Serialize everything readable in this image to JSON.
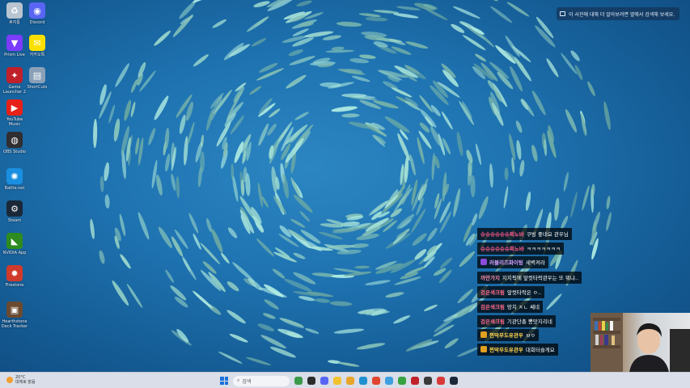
{
  "desktop": {
    "icons": [
      {
        "name": "recycle-bin",
        "label": "휴지통",
        "color": "#b8c4d0",
        "glyph": "♻"
      },
      {
        "name": "discord",
        "label": "Discord",
        "color": "#5865f2",
        "glyph": "◉"
      },
      {
        "name": "prism-live",
        "label": "Prism Live",
        "color": "#7a3cff",
        "glyph": "▼"
      },
      {
        "name": "kakaotalk",
        "label": "카카오톡",
        "color": "#f9e000",
        "glyph": "✉"
      },
      {
        "name": "game-app",
        "label": "Game Launcher 2",
        "color": "#c0202a",
        "glyph": "✦"
      },
      {
        "name": "shortcut",
        "label": "ShortCuts",
        "color": "#8aa0b8",
        "glyph": "▤"
      },
      {
        "name": "youtube-music",
        "label": "YouTube Music",
        "color": "#e62117",
        "glyph": "▶"
      },
      {
        "name": "obs-studio",
        "label": "OBS Studio",
        "color": "#302e31",
        "glyph": "◍"
      },
      {
        "name": "battlenet",
        "label": "Battle.net",
        "color": "#1a8fe0",
        "glyph": "✺"
      },
      {
        "name": "steam",
        "label": "Steam",
        "color": "#1b2838",
        "glyph": "⚙"
      },
      {
        "name": "nvidia",
        "label": "NVIDIA App",
        "color": "#2e8b1f",
        "glyph": "◣"
      },
      {
        "name": "firestone",
        "label": "Firestone",
        "color": "#d03a2a",
        "glyph": "✹"
      },
      {
        "name": "hearthstone",
        "label": "Hearthstone Deck Tracker",
        "color": "#6a4a30",
        "glyph": "▣"
      }
    ]
  },
  "hint": {
    "text": "이 사진에 대해 더 알아보려면 옆에서 검색해 보세요."
  },
  "chat": {
    "messages": [
      {
        "user": "슈슈슈슈슈슈찌노바",
        "text": "쿠빙 좋네요 관우님",
        "user_color": "#ff5b8a",
        "badge": null
      },
      {
        "user": "슈슈슈슈슈슈찌노바",
        "text": "ㅋㅋㅋㅋㅋㅋㅋ",
        "user_color": "#ff5b8a",
        "badge": null
      },
      {
        "user": "러블리즈화이팅",
        "text": "새벽켜라",
        "user_color": "#d9a0ff",
        "badge": "#8a4cd9"
      },
      {
        "user": "까만가지",
        "text": "지지픽에 앞컷타락관우는 또 뭐냐..",
        "user_color": "#ff8fa8",
        "badge": null
      },
      {
        "user": "검은색크림",
        "text": "앞컷타락은 ㅇ..",
        "user_color": "#ff6b8a",
        "badge": null
      },
      {
        "user": "검은색크림",
        "text": "망치 ㅈㄴ 쎄네",
        "user_color": "#ff6b8a",
        "badge": null
      },
      {
        "user": "검은색크림",
        "text": "기관단총 뽕맛지리네",
        "user_color": "#ff6b8a",
        "badge": null
      },
      {
        "user": "찐막무도유관우",
        "text": "ㅂㅇ",
        "user_color": "#ffd34d",
        "badge": "#e0a020"
      },
      {
        "user": "찐막무도유관우",
        "text": "대회터슬게요",
        "user_color": "#ffd34d",
        "badge": "#e0a020"
      }
    ]
  },
  "taskbar": {
    "weather_temp": "20°C",
    "weather_desc": "대체로 맑음",
    "search_placeholder": "검색",
    "apps": [
      {
        "name": "widgets",
        "color": "#3a9a4a"
      },
      {
        "name": "task-view",
        "color": "#2b2b2b"
      },
      {
        "name": "discord",
        "color": "#5865f2"
      },
      {
        "name": "file-explorer",
        "color": "#f2c230"
      },
      {
        "name": "folder",
        "color": "#e8a52a"
      },
      {
        "name": "edge",
        "color": "#1f8fd0"
      },
      {
        "name": "chrome",
        "color": "#e0452f"
      },
      {
        "name": "chrome-2",
        "color": "#3fa0e0"
      },
      {
        "name": "xbox",
        "color": "#37a33f"
      },
      {
        "name": "game-app",
        "color": "#c0202a"
      },
      {
        "name": "obs",
        "color": "#3a3a3a"
      },
      {
        "name": "camera",
        "color": "#d83a3a"
      },
      {
        "name": "steam",
        "color": "#1b2838"
      }
    ]
  }
}
